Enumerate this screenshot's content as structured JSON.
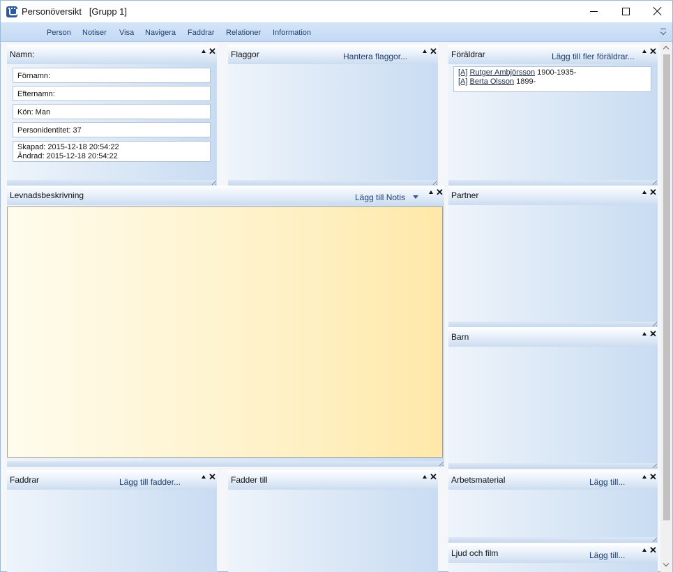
{
  "window": {
    "title": "Personöversikt   [Grupp 1]",
    "app_icon": "family-tree-app-icon"
  },
  "menu": {
    "items": [
      "Person",
      "Notiser",
      "Visa",
      "Navigera",
      "Faddrar",
      "Relationer",
      "Information"
    ]
  },
  "panels": {
    "namn": {
      "title": "Namn:",
      "fields": {
        "fornamn": "Förnamn:",
        "efternamn": "Efternamn:",
        "kon": "Kön: Man",
        "personidentitet": "Personidentitet: 37",
        "skapad": "Skapad: 2015-12-18 20:54:22",
        "andrad": "Ändrad: 2015-12-18 20:54:22"
      }
    },
    "flaggor": {
      "title": "Flaggor",
      "action": "Hantera flaggor..."
    },
    "foraldrar": {
      "title": "Föräldrar",
      "action": "Lägg till fler föräldrar...",
      "parents": [
        {
          "tag": "[A]",
          "name": "Rutger Ambjörsson",
          "years": "1900-1935-"
        },
        {
          "tag": "[A]",
          "name": "Berta Olsson",
          "years": "1899-"
        }
      ]
    },
    "levnad": {
      "title": "Levnadsbeskrivning",
      "action": "Lägg till Notis"
    },
    "partner": {
      "title": "Partner"
    },
    "barn": {
      "title": "Barn"
    },
    "faddrar": {
      "title": "Faddrar",
      "action": "Lägg till fadder..."
    },
    "fadder_till": {
      "title": "Fadder till"
    },
    "arbetsmaterial": {
      "title": "Arbetsmaterial",
      "action": "Lägg till..."
    },
    "ljud": {
      "title": "Ljud och film",
      "action": "Lägg till..."
    }
  }
}
